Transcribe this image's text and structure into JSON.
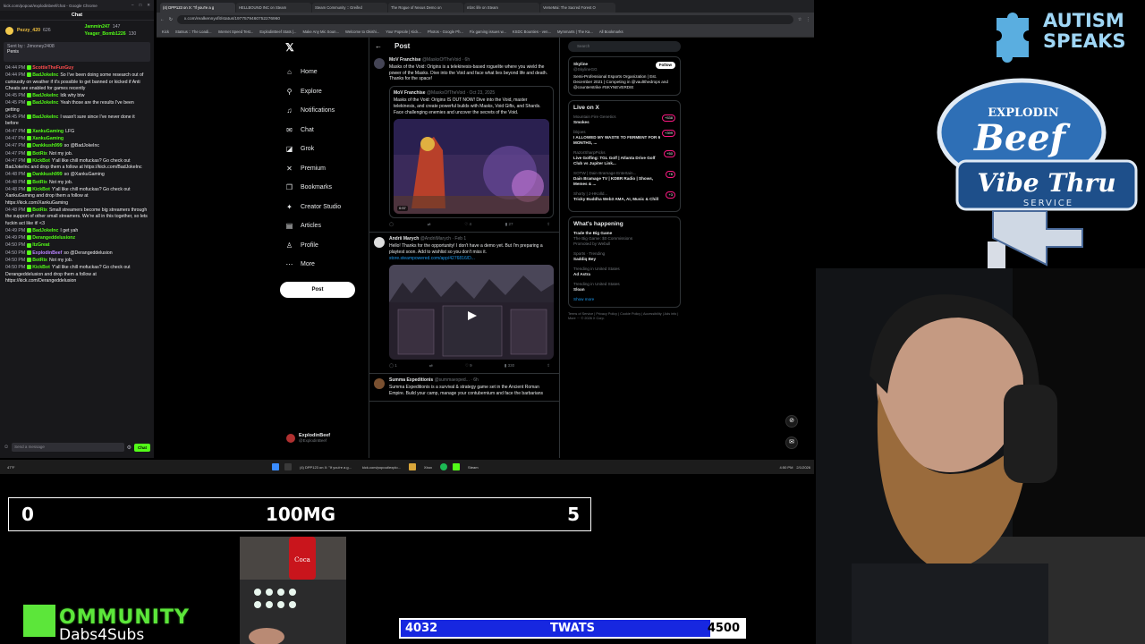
{
  "chat": {
    "window_title": "kick.com/popout/explodinbeef/chat - Google Chrome",
    "tab_title": "Chat",
    "leaderboard": [
      {
        "name": "Pezzy_420",
        "points": "626"
      },
      {
        "name": "Jammin247",
        "points": "147"
      },
      {
        "name": "Yeager_Bomb1226",
        "points": "130"
      }
    ],
    "pinned_by": "Sent by : Jimoney2408",
    "pinned_text": "Penis",
    "messages": [
      {
        "time": "04:44 PM",
        "user": "ScottieTheFunGuy",
        "color": "#ff4d4d",
        "text": ""
      },
      {
        "time": "04:44 PM",
        "user": "BadJokeInc",
        "color": "#53fc18",
        "text": "So I've been doing some research out of curiousity on weather if it's possible to get banned or kicked if Anti Cheats are enabled for games recently"
      },
      {
        "time": "04:45 PM",
        "user": "BadJokeInc",
        "color": "#53fc18",
        "text": "Idk why btw"
      },
      {
        "time": "04:45 PM",
        "user": "BadJokeInc",
        "color": "#53fc18",
        "text": "Yeah those are the results I've been getting"
      },
      {
        "time": "04:45 PM",
        "user": "BadJokeInc",
        "color": "#53fc18",
        "text": "I wasn't sure since I've never done it before"
      },
      {
        "time": "04:47 PM",
        "user": "XankuGaming",
        "color": "#53fc18",
        "text": "LFG"
      },
      {
        "time": "04:47 PM",
        "user": "XankuGaming",
        "color": "#53fc18",
        "text": ""
      },
      {
        "time": "04:47 PM",
        "user": "Dankkush999",
        "color": "#53fc18",
        "text": "so @BadJokeInc"
      },
      {
        "time": "04:47 PM",
        "user": "BotRix",
        "color": "#53fc18",
        "text": "Not my job."
      },
      {
        "time": "04:47 PM",
        "user": "KickBot",
        "color": "#53fc18",
        "text": "Y'all like chill mofuckas? Go check out BadJokeInc and drop them a follow at https://kick.com/BadJokeInc"
      },
      {
        "time": "04:48 PM",
        "user": "Dankkush999",
        "color": "#53fc18",
        "text": "so @XankuGaming"
      },
      {
        "time": "04:48 PM",
        "user": "BotRix",
        "color": "#53fc18",
        "text": "Not my job."
      },
      {
        "time": "04:48 PM",
        "user": "KickBot",
        "color": "#53fc18",
        "text": "Y'all like chill mofuckas? Go check out XankuGaming and drop them a follow at https://kick.com/XankuGaming"
      },
      {
        "time": "04:48 PM",
        "user": "BotRix",
        "color": "#53fc18",
        "text": "Small streamers become big streamers through the support of other small streamers. We're all in this together, so lets fuckin act like it! <3"
      },
      {
        "time": "04:49 PM",
        "user": "BadJokeInc",
        "color": "#53fc18",
        "text": "I get yah"
      },
      {
        "time": "04:49 PM",
        "user": "Derangeddelusionz",
        "color": "#53fc18",
        "text": ""
      },
      {
        "time": "04:50 PM",
        "user": "ItzGreat",
        "color": "#53fc18",
        "text": ""
      },
      {
        "time": "04:50 PM",
        "user": "ExplodinBeef",
        "color": "#b983ff",
        "text": "so @Derangeddelusion"
      },
      {
        "time": "04:50 PM",
        "user": "BotRix",
        "color": "#53fc18",
        "text": "Not my job."
      },
      {
        "time": "04:50 PM",
        "user": "KickBot",
        "color": "#53fc18",
        "text": "Y'all like chill mofuckas? Go check out Derangeddelusion and drop them a follow at https://kick.com/Derangeddelusion"
      }
    ],
    "input_placeholder": "Send a message",
    "send_label": "Chat"
  },
  "browser": {
    "tabs": [
      "(4) DPP123 on X: \"If you're a g",
      "HELLBOUND INC on Steam",
      "Steam Community :: Greifed",
      "The Rogue of Nexus Demo on",
      "mbrc life on Steam",
      "VerseMai: The Sacred Forest O"
    ],
    "url": "x.com/realkennyxfit/status/1977579460752276960",
    "bookmarks": [
      "Kick",
      "Statsus :: The Loadi...",
      "Internet Speed Test...",
      "ExplodinBeef Stats |...",
      "Make Any Mic Soun...",
      "Welcome to Okishi...",
      "Your Popsole | Kick...",
      "Photos - Google Ph...",
      "Fix gaming issues w...",
      "KSDC Bounties - ven...",
      "Mymmarts | The Ka...",
      "All Bookmarks"
    ]
  },
  "x": {
    "nav": [
      {
        "icon": "home-icon",
        "glyph": "⌂",
        "label": "Home"
      },
      {
        "icon": "explore-icon",
        "glyph": "⚲",
        "label": "Explore"
      },
      {
        "icon": "bell-icon",
        "glyph": "♫",
        "label": "Notifications"
      },
      {
        "icon": "chat-icon",
        "glyph": "✉",
        "label": "Chat"
      },
      {
        "icon": "grok-icon",
        "glyph": "◪",
        "label": "Grok"
      },
      {
        "icon": "x-icon",
        "glyph": "✕",
        "label": "Premium"
      },
      {
        "icon": "bookmark-icon",
        "glyph": "❒",
        "label": "Bookmarks"
      },
      {
        "icon": "creator-icon",
        "glyph": "✦",
        "label": "Creator Studio"
      },
      {
        "icon": "articles-icon",
        "glyph": "▤",
        "label": "Articles"
      },
      {
        "icon": "profile-icon",
        "glyph": "♙",
        "label": "Profile"
      },
      {
        "icon": "more-icon",
        "glyph": "⋯",
        "label": "More"
      }
    ],
    "post_button": "Post",
    "account_name": "ExplodinBeef",
    "account_handle": "@ExplodinBeef",
    "timeline_title": "Post",
    "tweets": [
      {
        "name": "MoV Franchise",
        "handle": "@MasksOfTheVoid · 6h",
        "body": "Masks of the Void: Origins is a telekinesis-based roguelite where you wield the power of the Masks. Dive into the Void and face what lies beyond life and death. Thanks for the space!",
        "quote_name": "MoV Franchise",
        "quote_handle": "@MasksOfTheVoid · Oct 23, 2025",
        "quote_body": "Masks of the Void: Origins IS OUT NOW! Dive into the Void, master telekinesis, and create powerful builds with Masks, Void Gifts, and Shards. Face challenging enemies and uncover the secrets of the Void.",
        "duration": "0:57",
        "actions": [
          "",
          "",
          "4",
          "27",
          ""
        ]
      },
      {
        "name": "Andrii Marych",
        "handle": "@AndriiMarych · Feb 1",
        "body": "Hello! Thanks for the opportunity! I don't have a demo yet. But I'm preparing a playtest soon. Add to wishlist so you don't miss it.",
        "link": "store.steampowered.com/app/4276816/D...",
        "actions": [
          "1",
          "",
          "9",
          "330",
          ""
        ]
      },
      {
        "name": "Summa Expeditionis",
        "handle": "@summaexped... · 6h",
        "body": "Summa Expeditionis is a survival & strategy game set in the Ancient Roman Empire. Build your camp, manage your contubernium and face the barbarians"
      }
    ],
    "search_placeholder": "Search",
    "profile_card": {
      "name": "Skyline",
      "handle": "@SkylineGG",
      "follow": "Follow",
      "bio": "Semi-Professional Esports Organization | Est. December 2021 | Competing in @vaultthedrops and @counterstrike #SKYNEVERDIE"
    },
    "live_title": "Live on X",
    "live": [
      {
        "host": "Mountain Fire Genetics",
        "title": "Smokes",
        "count": "+538"
      },
      {
        "host": "bbjoes",
        "title": "I ALLOWED MY WASTE TO FERMENT FOR 6 MONTHS, ...",
        "count": "+399"
      },
      {
        "host": "RazorSharpPicks",
        "title": "Live Golfing: TGL Golf | Atlanta Drive Golf Club vs Jupiter Link...",
        "count": "+50"
      },
      {
        "host": "SOTW | Dain Bramage Entertain...",
        "title": "Dain Bramage TV | KDBR Radio | Shows, Memes & ...",
        "count": "+6"
      },
      {
        "host": "Shorty | J-HKolld...",
        "title": "Tricky Buddha Web3 AMA, AI, Music & Chill",
        "count": "+3"
      }
    ],
    "happening_title": "What's happening",
    "trends": [
      {
        "context": "",
        "title": "Trade the Big Game",
        "sub": "The Big Game: $0 Commissions",
        "promo": "Promoted by Webull"
      },
      {
        "context": "Sports · Trending",
        "title": "Saddiq Bey",
        "sub": "",
        "promo": ""
      },
      {
        "context": "Trending in United States",
        "title": "Ad Astra",
        "sub": "",
        "promo": ""
      },
      {
        "context": "Trending in United States",
        "title": "Sloan",
        "sub": "",
        "promo": ""
      }
    ],
    "show_more": "Show more",
    "footer": "Terms of Service | Privacy Policy | Cookie Policy | Accessibility | Ads info | More ··· © 2026 X Corp."
  },
  "taskbar": {
    "weather": "47°F",
    "items": [
      "(4) DPP123 on X: \"If you're a g...",
      "kick.com/popout/explo...",
      "Xbox",
      "Steam"
    ],
    "time": "4:50 PM",
    "date": "2/1/2026"
  },
  "overlay": {
    "counter_top": {
      "left": "0",
      "label": "100MG",
      "right": "5"
    },
    "counter_bottom": {
      "current": "4032",
      "label": "TWATS",
      "goal": "4500",
      "progress": 0.896
    },
    "kommunity_title": "OMMUNITY",
    "kommunity_k": "K",
    "kommunity_sub": "Dabs4Subs",
    "autism_logo": "AUTISM SPEAKS",
    "autism_line1": "AUTISM",
    "autism_line2": "SPEAKS",
    "sign_top": "EXPLODIN",
    "sign_beef": "Beef",
    "sign_vibe": "Vibe Thru",
    "sign_service": "SERVICE"
  },
  "colors": {
    "kick_green": "#53fc18",
    "x_blue": "#1d9bf0",
    "counter_blue": "#1727e0",
    "kommunity_green": "#5ce63a"
  }
}
